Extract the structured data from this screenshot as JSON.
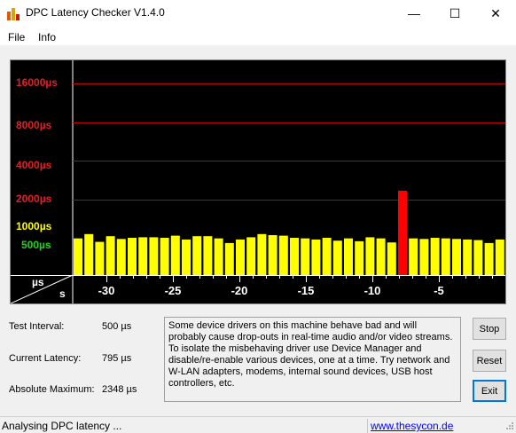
{
  "window": {
    "title": "DPC Latency Checker V1.4.0",
    "minimize_glyph": "—",
    "maximize_glyph": "☐",
    "close_glyph": "✕"
  },
  "menu": {
    "items": [
      "File",
      "Info"
    ]
  },
  "chart": {
    "y_labels": [
      {
        "text": "16000µs",
        "color": "#e02020"
      },
      {
        "text": "8000µs",
        "color": "#e02020"
      },
      {
        "text": "4000µs",
        "color": "#e02020"
      },
      {
        "text": "2000µs",
        "color": "#e02020"
      },
      {
        "text": "1000µs",
        "color": "#ffff00"
      },
      {
        "text": "500µs",
        "color": "#20d020"
      }
    ],
    "x_unit_top": "µs",
    "x_unit_bottom": "s",
    "x_ticks": [
      "-30",
      "-25",
      "-20",
      "-15",
      "-10",
      "-5"
    ]
  },
  "chart_data": {
    "type": "bar",
    "ylabel": "µs",
    "xlabel": "s",
    "y_ticks": [
      500,
      1000,
      2000,
      4000,
      8000,
      16000
    ],
    "x_ticks": [
      -30,
      -25,
      -20,
      -15,
      -10,
      -5
    ],
    "values": [
      1000,
      1080,
      940,
      1040,
      990,
      1010,
      1020,
      1020,
      1010,
      1050,
      980,
      1040,
      1040,
      1000,
      920,
      980,
      1020,
      1080,
      1060,
      1050,
      1010,
      1000,
      980,
      1010,
      960,
      1000,
      950,
      1020,
      1000,
      930,
      2348,
      1000,
      990,
      1010,
      1000,
      990,
      980,
      970,
      920,
      980
    ],
    "colors": {
      "normal": "#ffff00",
      "peak": "#ff0000",
      "grid": "#c00000",
      "background": "#000000"
    }
  },
  "info": {
    "test_interval_label": "Test Interval:",
    "test_interval_value": "500 µs",
    "current_latency_label": "Current Latency:",
    "current_latency_value": "795 µs",
    "absolute_max_label": "Absolute Maximum:",
    "absolute_max_value": "2348 µs"
  },
  "description": "Some device drivers on this machine behave bad and will probably cause drop-outs in real-time audio and/or video streams. To isolate the misbehaving driver use Device Manager and disable/re-enable various devices, one at a time. Try network and W-LAN adapters, modems, internal sound devices, USB host controllers, etc.",
  "buttons": {
    "stop": "Stop",
    "reset": "Reset",
    "exit": "Exit"
  },
  "status": {
    "text": "Analysing DPC latency ...",
    "link": "www.thesycon.de"
  }
}
